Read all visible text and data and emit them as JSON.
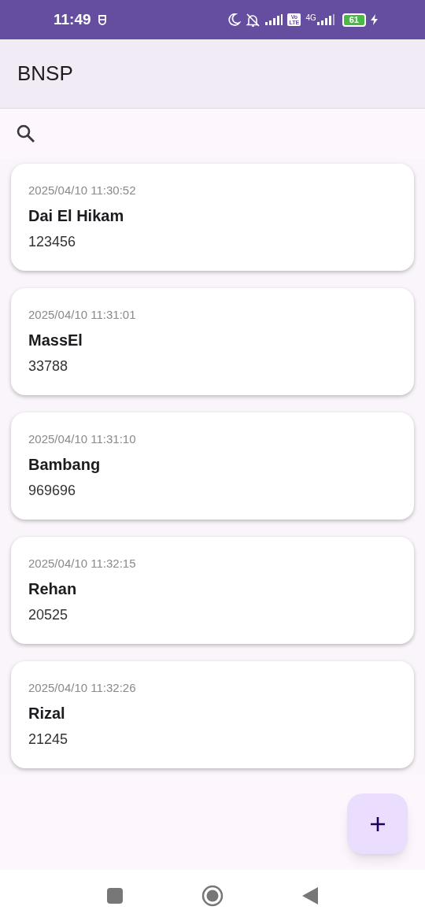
{
  "status_bar": {
    "time": "11:49",
    "network_badge": "Vo LTE",
    "network_type": "4G",
    "battery": "61"
  },
  "app_bar": {
    "title": "BNSP"
  },
  "entries": [
    {
      "timestamp": "2025/04/10 11:30:52",
      "name": "Dai El Hikam",
      "number": "123456"
    },
    {
      "timestamp": "2025/04/10 11:31:01",
      "name": "MassEl",
      "number": "33788"
    },
    {
      "timestamp": "2025/04/10 11:31:10",
      "name": "Bambang",
      "number": "969696"
    },
    {
      "timestamp": "2025/04/10 11:32:15",
      "name": "Rehan",
      "number": "20525"
    },
    {
      "timestamp": "2025/04/10 11:32:26",
      "name": "Rizal",
      "number": "21245"
    }
  ]
}
